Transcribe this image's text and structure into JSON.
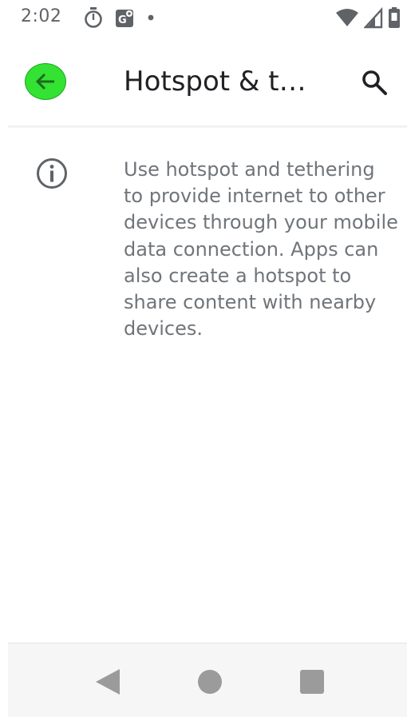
{
  "status_bar": {
    "time": "2:02",
    "icons": [
      "timer-icon",
      "maps-notification-icon",
      "dot-icon",
      "wifi-icon",
      "signal-icon",
      "battery-icon"
    ]
  },
  "app_bar": {
    "title": "Hotspot & t…",
    "back_icon": "arrow-left-icon",
    "search_icon": "search-icon",
    "back_color": "#33e233"
  },
  "content": {
    "info_icon": "info-icon",
    "info_text": "Use hotspot and tethering to provide internet to other devices through your mobile data connection. Apps can also create a hotspot to share content with nearby devices."
  },
  "nav_bar": {
    "buttons": [
      "back-triangle-icon",
      "home-circle-icon",
      "recents-square-icon"
    ]
  }
}
